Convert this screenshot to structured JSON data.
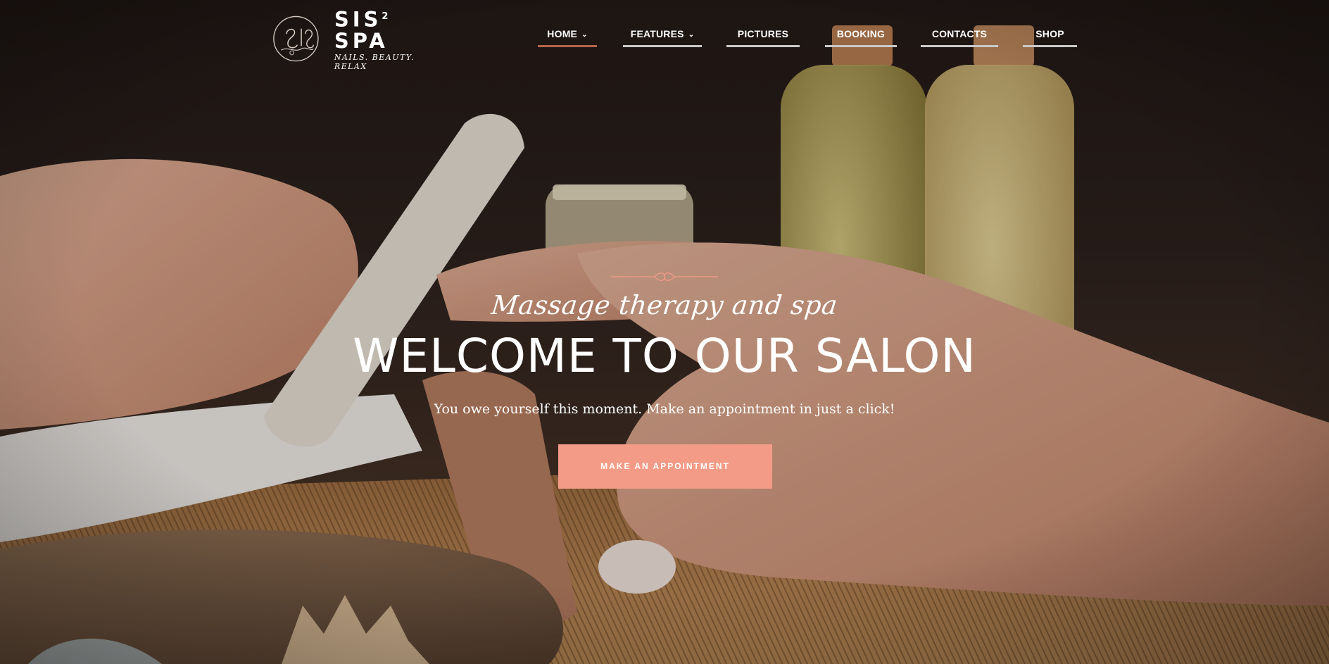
{
  "brand": {
    "name": "SIS",
    "superscript": "2",
    "name_suffix": "SPA",
    "tagline": "NAILS. BEAUTY. RELAX",
    "logo_icon": "spa-logo-icon"
  },
  "nav": {
    "items": [
      {
        "label": "HOME",
        "has_dropdown": true,
        "active": true
      },
      {
        "label": "FEATURES",
        "has_dropdown": true,
        "active": false
      },
      {
        "label": "PICTURES",
        "has_dropdown": false,
        "active": false
      },
      {
        "label": "BOOKING",
        "has_dropdown": false,
        "active": false
      },
      {
        "label": "CONTACTS",
        "has_dropdown": false,
        "active": false
      },
      {
        "label": "SHOP",
        "has_dropdown": false,
        "active": false
      }
    ],
    "chevron_icon": "chevron-down-icon",
    "active_color": "#b5654a",
    "underline_color": "#c9c9c9"
  },
  "hero": {
    "script_line": "Massage therapy and spa",
    "headline": "WELCOME TO OUR SALON",
    "subtitle": "You owe yourself this moment. Make an appointment in just a click!",
    "cta_label": "MAKE AN APPOINTMENT",
    "cta_color": "#f39b87"
  }
}
